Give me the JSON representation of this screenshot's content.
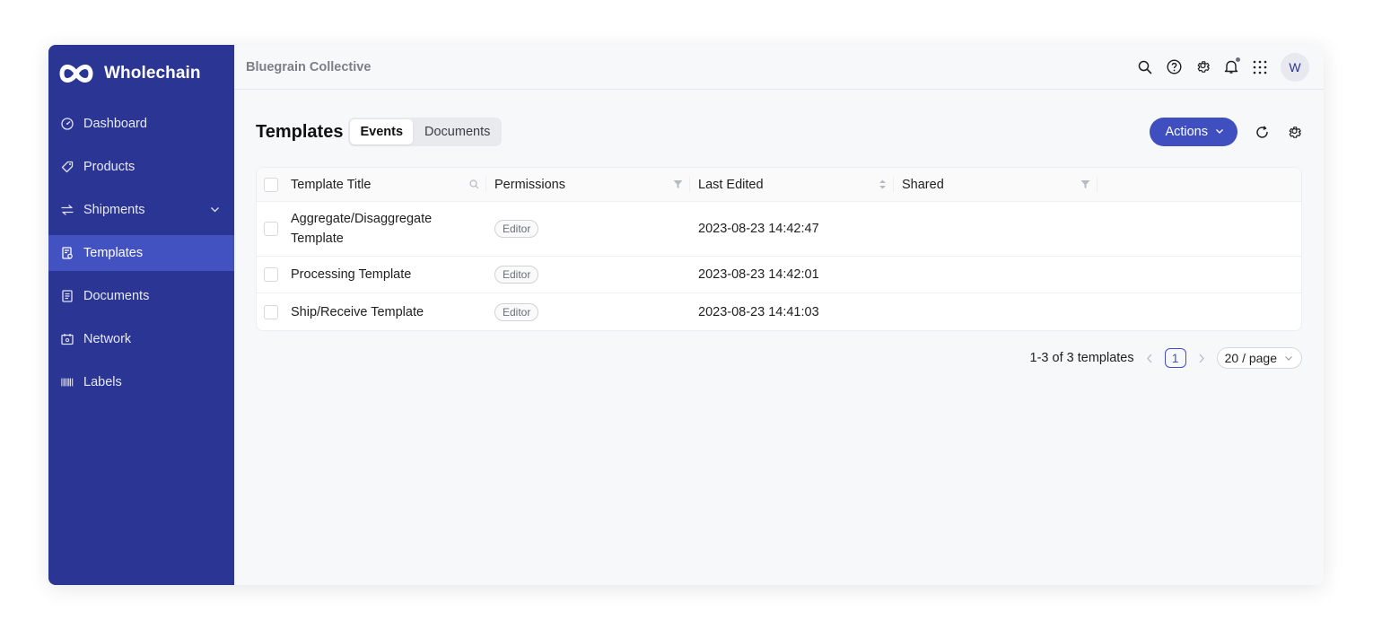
{
  "brand": {
    "name": "Wholechain"
  },
  "sidebar": {
    "items": [
      {
        "label": "Dashboard",
        "icon": "dashboard-icon",
        "active": false
      },
      {
        "label": "Products",
        "icon": "tag-icon",
        "active": false
      },
      {
        "label": "Shipments",
        "icon": "transfer-icon",
        "active": false,
        "expandable": true
      },
      {
        "label": "Templates",
        "icon": "template-icon",
        "active": true
      },
      {
        "label": "Documents",
        "icon": "document-icon",
        "active": false
      },
      {
        "label": "Network",
        "icon": "network-icon",
        "active": false
      },
      {
        "label": "Labels",
        "icon": "barcode-icon",
        "active": false
      }
    ]
  },
  "topbar": {
    "organization": "Bluegrain Collective",
    "avatar_initial": "W"
  },
  "page": {
    "title": "Templates",
    "tabs": [
      {
        "label": "Events",
        "active": true
      },
      {
        "label": "Documents",
        "active": false
      }
    ],
    "actions_label": "Actions"
  },
  "table": {
    "columns": [
      "Template Title",
      "Permissions",
      "Last Edited",
      "Shared"
    ],
    "rows": [
      {
        "title": "Aggregate/Disaggregate Template",
        "permission": "Editor",
        "last_edited": "2023-08-23 14:42:47",
        "shared": ""
      },
      {
        "title": "Processing Template",
        "permission": "Editor",
        "last_edited": "2023-08-23 14:42:01",
        "shared": ""
      },
      {
        "title": "Ship/Receive Template",
        "permission": "Editor",
        "last_edited": "2023-08-23 14:41:03",
        "shared": ""
      }
    ]
  },
  "pagination": {
    "summary": "1-3 of 3 templates",
    "current_page": "1",
    "page_size": "20 / page"
  },
  "colors": {
    "sidebar": "#2b3594",
    "sidebar_active": "#4352c1",
    "primary": "#3f4fbf",
    "background": "#f7f8fa"
  }
}
